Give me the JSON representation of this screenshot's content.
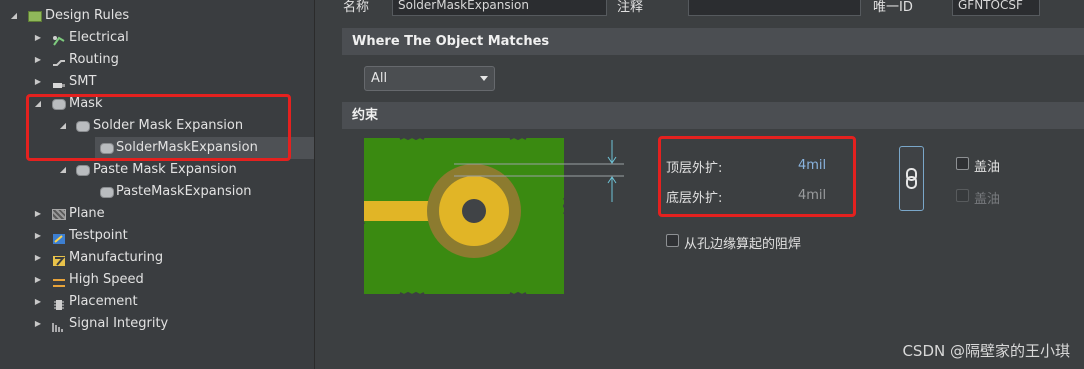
{
  "tree": {
    "root": "Design Rules",
    "items": [
      {
        "label": "Electrical"
      },
      {
        "label": "Routing"
      },
      {
        "label": "SMT"
      },
      {
        "label": "Mask"
      },
      {
        "label": "Solder Mask Expansion"
      },
      {
        "label": "SolderMaskExpansion"
      },
      {
        "label": "Paste Mask Expansion"
      },
      {
        "label": "PasteMaskExpansion"
      },
      {
        "label": "Plane"
      },
      {
        "label": "Testpoint"
      },
      {
        "label": "Manufacturing"
      },
      {
        "label": "High Speed"
      },
      {
        "label": "Placement"
      },
      {
        "label": "Signal Integrity"
      }
    ]
  },
  "header": {
    "name_label": "名称",
    "name_value": "SolderMaskExpansion",
    "comment_label": "注释",
    "comment_value": "",
    "uid_label": "唯一ID",
    "uid_value": "GFNTOCSF"
  },
  "where": {
    "title": "Where The Object Matches",
    "dropdown_value": "All"
  },
  "constraints": {
    "title": "约束",
    "top_label": "顶层外扩:",
    "top_value": "4mil",
    "bottom_label": "底层外扩:",
    "bottom_value": "4mil",
    "tent1_label": "盖油",
    "tent2_label": "盖油",
    "from_hole_label": "从孔边缘算起的阻焊"
  },
  "colors": {
    "highlight_box": "#e4211f",
    "pcb_green": "#3a8a11",
    "pad_gold": "#e1b526",
    "mask_ring": "#8c7b2f",
    "value_blue": "#8ab4e0"
  },
  "watermark": "CSDN @隔壁家的王小琪"
}
